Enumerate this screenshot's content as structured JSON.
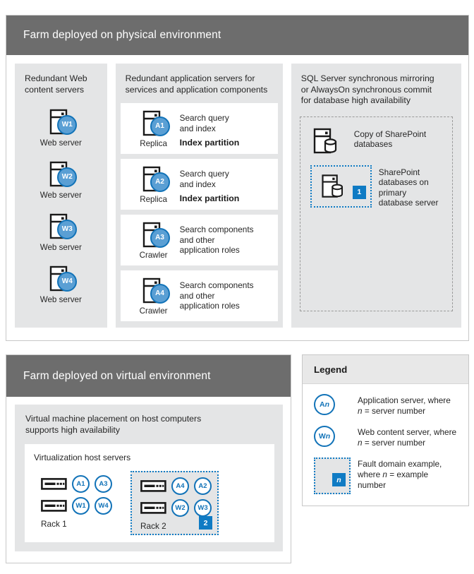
{
  "colors": {
    "header_gray": "#6d6d6d",
    "panel_gray": "#e4e5e6",
    "accent_blue": "#0f7bc4",
    "ring_blue": "#1273b8",
    "circle_fill": "#5a9fd4"
  },
  "physical": {
    "title": "Farm deployed on physical environment",
    "web": {
      "panel_title": "Redundant Web\ncontent servers",
      "servers": [
        {
          "tag": "W1",
          "caption": "Web server"
        },
        {
          "tag": "W2",
          "caption": "Web server"
        },
        {
          "tag": "W3",
          "caption": "Web server"
        },
        {
          "tag": "W4",
          "caption": "Web server"
        }
      ]
    },
    "app": {
      "panel_title": "Redundant application servers for\nservices and application components",
      "rows": [
        {
          "tag": "A1",
          "caption": "Replica",
          "line1": "Search query",
          "line2": "and index",
          "strong": "Index partition"
        },
        {
          "tag": "A2",
          "caption": "Replica",
          "line1": "Search query",
          "line2": "and index",
          "strong": "Index partition"
        },
        {
          "tag": "A3",
          "caption": "Crawler",
          "line1": "Search components",
          "line2": "and other",
          "line3": "application roles",
          "strong": ""
        },
        {
          "tag": "A4",
          "caption": "Crawler",
          "line1": "Search components",
          "line2": "and other",
          "line3": "application roles",
          "strong": ""
        }
      ]
    },
    "sql": {
      "panel_title": "SQL Server synchronous mirroring\nor AlwaysOn synchronous commit\nfor database high availability",
      "copy_label": "Copy of SharePoint\ndatabases",
      "primary_label": "SharePoint\ndatabases on\nprimary\ndatabase server",
      "primary_badge": "1"
    }
  },
  "virtual": {
    "title": "Farm deployed on virtual environment",
    "panel_title": "Virtual machine placement on host computers\nsupports high availability",
    "host_title": "Virtualization host servers",
    "racks": [
      {
        "label": "Rack 1",
        "fault_domain": false,
        "badge": "",
        "row1": [
          "A1",
          "A3"
        ],
        "row2": [
          "W1",
          "W4"
        ]
      },
      {
        "label": "Rack 2",
        "fault_domain": true,
        "badge": "2",
        "row1": [
          "A4",
          "A2"
        ],
        "row2": [
          "W2",
          "W3"
        ]
      }
    ]
  },
  "legend": {
    "title": "Legend",
    "items": [
      {
        "key_type": "circle",
        "key_prefix": "A",
        "key_suffix": "n",
        "line1": "Application server, where",
        "line2_pre": "",
        "line2_italic": "n",
        "line2_post": " = server number"
      },
      {
        "key_type": "circle",
        "key_prefix": "W",
        "key_suffix": "n",
        "line1": "Web content server, where",
        "line2_pre": "",
        "line2_italic": "n",
        "line2_post": " = server number"
      },
      {
        "key_type": "fault",
        "badge": "n",
        "line1": "Fault domain example,",
        "line2_pre": "where ",
        "line2_italic": "n",
        "line2_post": " = example",
        "line3": "number"
      }
    ]
  }
}
